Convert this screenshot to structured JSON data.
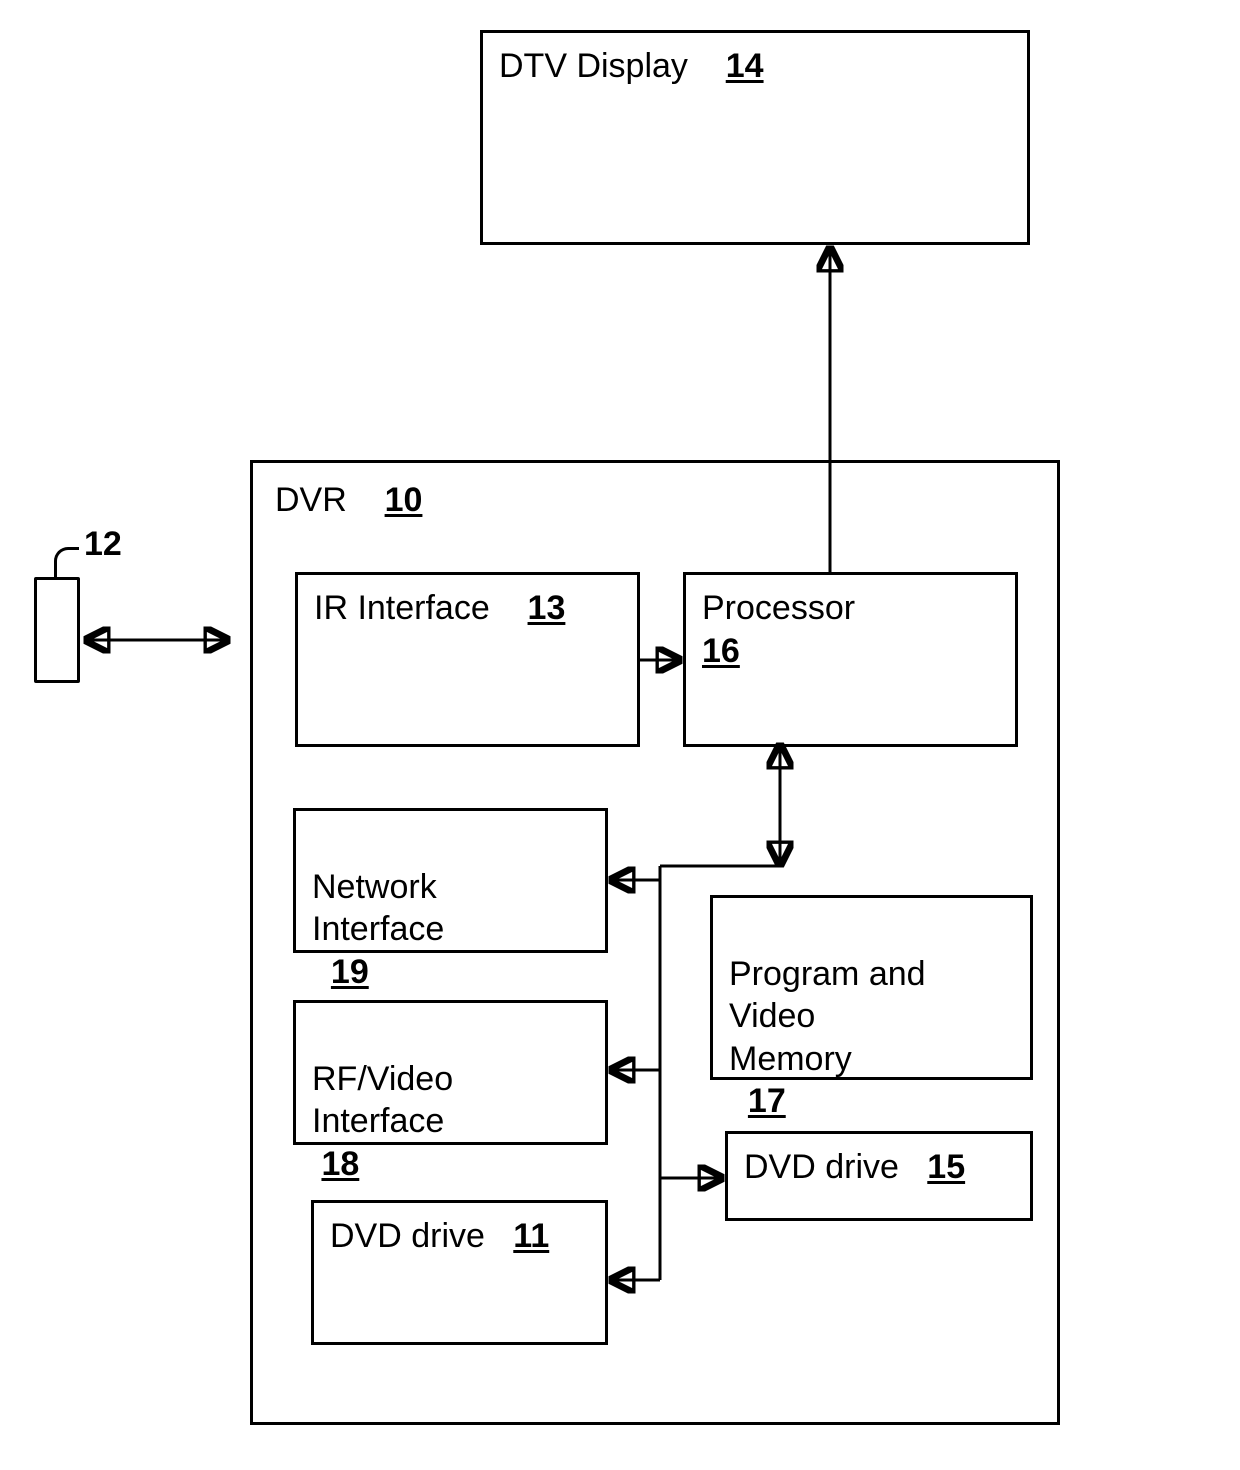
{
  "blocks": {
    "dtv_display": {
      "label": "DTV Display",
      "ref": "14"
    },
    "dvr": {
      "label": "DVR",
      "ref": "10"
    },
    "ir_interface": {
      "label": "IR Interface",
      "ref": "13"
    },
    "processor": {
      "label": "Processor",
      "ref": "16"
    },
    "network_if": {
      "label": "Network\nInterface",
      "ref": "19"
    },
    "rfvideo_if": {
      "label": "RF/Video\nInterface",
      "ref": "18"
    },
    "dvd_drive_l": {
      "label": "DVD drive",
      "ref": "11"
    },
    "prog_mem": {
      "label": "Program and\nVideo\nMemory",
      "ref": "17"
    },
    "dvd_drive_r": {
      "label": "DVD drive",
      "ref": "15"
    },
    "remote": {
      "ref": "12"
    }
  }
}
